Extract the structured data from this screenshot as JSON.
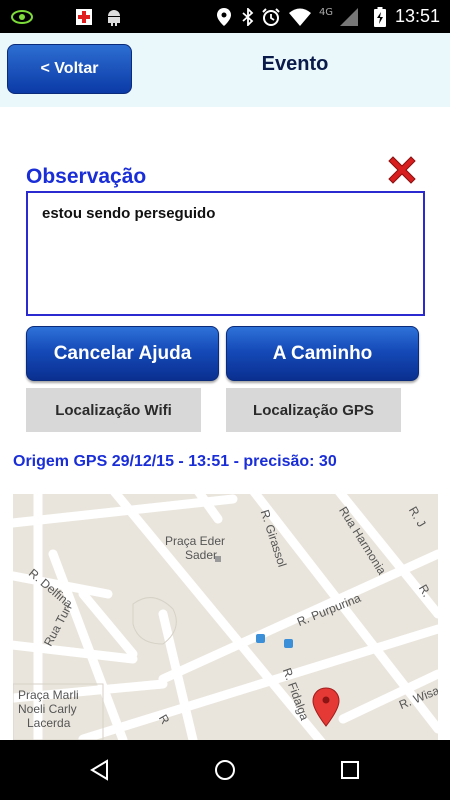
{
  "status_bar": {
    "time": "13:51",
    "network_label": "4G",
    "icons": [
      "eye-icon",
      "red-cross-icon",
      "android-robot-icon",
      "location-pin-icon",
      "bluetooth-icon",
      "alarm-icon",
      "wifi-icon",
      "signal-icon",
      "battery-icon"
    ]
  },
  "header": {
    "back_label": "< Voltar",
    "title": "Evento",
    "background": "#eaf8fb"
  },
  "observation": {
    "label": "Observação",
    "value": "estou sendo perseguido"
  },
  "buttons": {
    "cancel_help": "Cancelar Ajuda",
    "on_my_way": "A Caminho",
    "wifi_location": "Localização Wifi",
    "gps_location": "Localização GPS"
  },
  "origin_text": "Origem GPS 29/12/15 - 13:51 - precisão: 30",
  "map": {
    "labels": {
      "praca_eder_sader": "Praça Eder",
      "praca_eder_sader_2": "Sader",
      "r_girassol": "R. Girassol",
      "rua_harmonia": "Rua Harmonia",
      "r_delfina": "R. Delfina",
      "rua_turi": "Rua Turi",
      "r_purpurina": "R. Purpurina",
      "r_fidalga": "R. Fidalga",
      "r_wisard": "R. Wisa",
      "praca_marli_1": "Praça Marli",
      "praca_marli_2": "Noeli Carly",
      "praca_marli_3": "Lacerda",
      "r_j": "R. J",
      "r_f": "R",
      "r_corner": "R."
    },
    "pin_color": "#e53935"
  },
  "colors": {
    "accent_blue": "#1a2ed8",
    "button_blue": "#154ab8"
  },
  "nav": {
    "icons": [
      "back-triangle-icon",
      "home-circle-icon",
      "recents-square-icon"
    ]
  }
}
